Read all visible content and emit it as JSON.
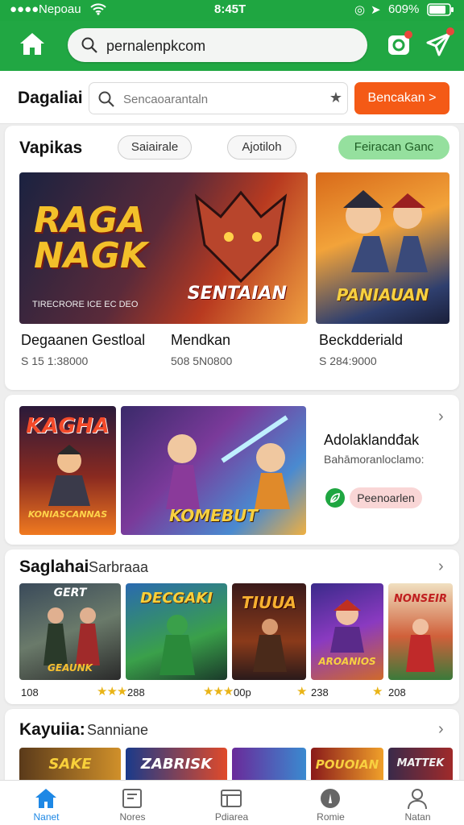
{
  "status_bar": {
    "carrier": "Nepoau",
    "time": "8:45T",
    "battery": "609%"
  },
  "topbar": {
    "url": "pernalenpkcom"
  },
  "search": {
    "label": "Dagaliai",
    "placeholder": "Sencaoarantaln",
    "button": "Bencakan >"
  },
  "featured": {
    "title": "Vapikas",
    "chips": [
      "Saiairale",
      "Ajotiloh",
      "Feiracan Ganc"
    ],
    "games": [
      {
        "art": "RAGA NAGK",
        "caption": "SENTAIAN",
        "title": "Degaanen Gestloal",
        "price": "S 15 1:38000"
      },
      {
        "art": "",
        "caption": "",
        "title": "Mendkan",
        "price": "508 5N0800"
      },
      {
        "art": "",
        "caption": "PANIAUAN",
        "title": "Beckdderiald",
        "price": "S 284:9000"
      }
    ],
    "tile_footer": "TIRECRORE ICE EC DEO"
  },
  "promo": {
    "left_art": "KAGHA",
    "left_caption": "KONIASCANNAS",
    "right_caption": "KOMEBUT",
    "title": "Adolaklandđak",
    "subtitle": "Bahāmoranloclamo:",
    "button": "Peenoarlen"
  },
  "section2": {
    "title": "Saglahai",
    "subtitle": "Sarbraaa",
    "games": [
      {
        "art": "GERT",
        "caption": "GEAUNK",
        "rating": "108"
      },
      {
        "art": "DECGAKI",
        "caption": "",
        "rating": "288"
      },
      {
        "art": "TIUUA",
        "caption": "",
        "rating": "00p"
      },
      {
        "art": "",
        "caption": "AROANIOS",
        "rating": "238"
      },
      {
        "art": "NONSEIR",
        "caption": "",
        "rating": "208"
      }
    ]
  },
  "section3": {
    "title": "Kayuiia:",
    "subtitle": "Sanniane",
    "games": [
      {
        "art": "SAKE"
      },
      {
        "art": "ZABRISK"
      },
      {
        "art": ""
      },
      {
        "art": "POUOIAN"
      },
      {
        "art": "MATTEK"
      }
    ]
  },
  "tabs": [
    {
      "label": "Nanet",
      "icon": "home-icon"
    },
    {
      "label": "Nores",
      "icon": "news-icon"
    },
    {
      "label": "Pdiarea",
      "icon": "store-icon"
    },
    {
      "label": "Romie",
      "icon": "compass-icon"
    },
    {
      "label": "Natan",
      "icon": "profile-icon"
    }
  ],
  "colors": {
    "brand_green": "#21a743",
    "accent_orange": "#f45a16",
    "chip_green": "#95e09e",
    "active_tab": "#1e88e5",
    "star": "#e9b417"
  }
}
